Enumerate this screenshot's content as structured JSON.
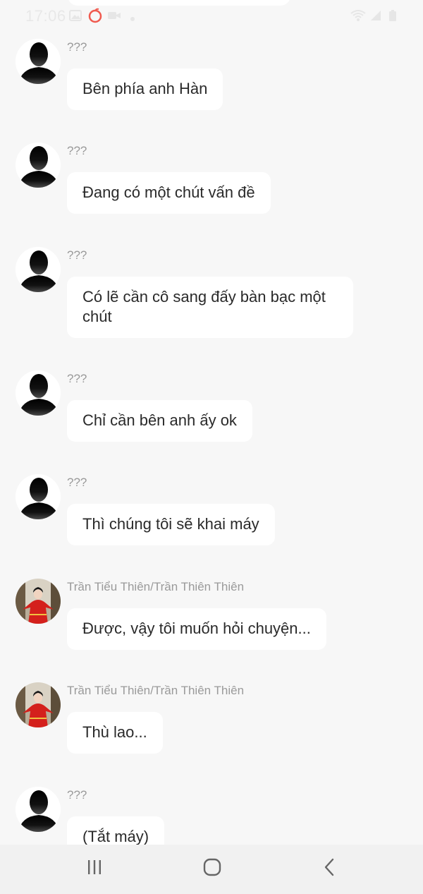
{
  "status_bar": {
    "time": "17:06",
    "icons": [
      "image-icon",
      "notification-app-icon",
      "video-icon",
      "dot-icon",
      "wifi-icon",
      "signal-icon",
      "battery-icon"
    ]
  },
  "messages": [
    {
      "sender": "???",
      "avatar": "silhouette-avatar",
      "text": "Bên phía anh Hàn"
    },
    {
      "sender": "???",
      "avatar": "silhouette-avatar",
      "text": "Đang có một chút vấn đề"
    },
    {
      "sender": "???",
      "avatar": "silhouette-avatar",
      "text": "Có lẽ cần cô sang đấy bàn bạc một chút"
    },
    {
      "sender": "???",
      "avatar": "silhouette-avatar",
      "text": "Chỉ cần bên anh ấy ok"
    },
    {
      "sender": "???",
      "avatar": "silhouette-avatar",
      "text": "Thì chúng tôi sẽ khai máy"
    },
    {
      "sender": "Trần Tiểu Thiên/Trần Thiên Thiên",
      "avatar": "photo-avatar-red-dress",
      "text": "Được, vậy tôi muốn hỏi chuyện..."
    },
    {
      "sender": "Trần Tiểu Thiên/Trần Thiên Thiên",
      "avatar": "photo-avatar-red-dress",
      "text": "Thù lao..."
    },
    {
      "sender": "???",
      "avatar": "silhouette-avatar",
      "text": "(Tắt máy)"
    }
  ],
  "nav_bar": {
    "buttons": [
      "recent-apps-icon",
      "home-icon",
      "back-icon"
    ]
  },
  "colors": {
    "background": "#f7f7f7",
    "bubble": "#ffffff",
    "sender_name": "#9a9a9a",
    "message_text": "#2a2a2a",
    "nav_background": "#f1f1f1",
    "notification_accent": "#f05a4f"
  }
}
